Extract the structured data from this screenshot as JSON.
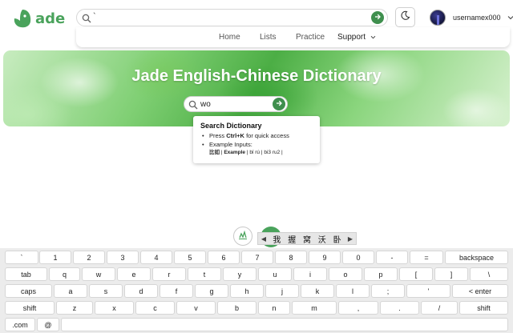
{
  "app": {
    "logo_text": "ade",
    "brand_color": "#4aa35c",
    "accent_color": "#3f8f4e"
  },
  "header": {
    "search_value": "`",
    "search_icon": "search-icon",
    "go_icon": "arrow-right-icon",
    "theme_icon": "moon-icon",
    "user": {
      "name": "usernamex000",
      "chevron_icon": "chevron-down-icon"
    }
  },
  "nav": {
    "items": [
      "Home",
      "Lists",
      "Practice",
      "Support"
    ]
  },
  "banner": {
    "title": "Jade English-Chinese Dictionary"
  },
  "main_search": {
    "value": "wo"
  },
  "dropdown": {
    "title": "Search Dictionary",
    "press_prefix": "Press ",
    "shortcut": "Ctrl+K",
    "press_suffix": " for quick access",
    "examples_label": "Example Inputs:",
    "examples": [
      "比如",
      "Example",
      "bǐ rú",
      "bi3 ru2"
    ],
    "separator": " | "
  },
  "ime": {
    "prev_icon": "triangle-left-icon",
    "next_icon": "triangle-right-icon",
    "candidates": [
      "我",
      "握",
      "窝",
      "沃",
      "卧"
    ]
  },
  "keyboard": {
    "row1": [
      "`",
      "1",
      "2",
      "3",
      "4",
      "5",
      "6",
      "7",
      "8",
      "9",
      "0",
      "-",
      "=",
      "backspace"
    ],
    "row2": [
      "tab",
      "q",
      "w",
      "e",
      "r",
      "t",
      "y",
      "u",
      "i",
      "o",
      "p",
      "[",
      "]",
      "\\"
    ],
    "row3": [
      "caps",
      "a",
      "s",
      "d",
      "f",
      "g",
      "h",
      "j",
      "k",
      "l",
      ";",
      "'",
      "< enter"
    ],
    "row4": [
      "shift",
      "z",
      "x",
      "c",
      "v",
      "b",
      "n",
      "m",
      ",",
      ".",
      "/",
      "shift"
    ],
    "row5": [
      ".com",
      "@",
      ""
    ]
  }
}
